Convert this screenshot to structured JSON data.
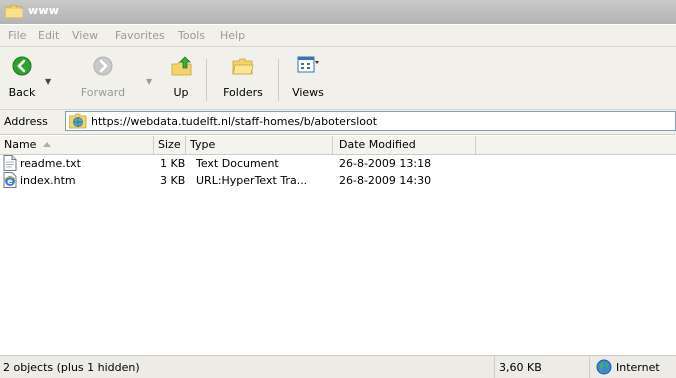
{
  "window": {
    "title": "www"
  },
  "menu": [
    "File",
    "Edit",
    "View",
    "Favorites",
    "Tools",
    "Help"
  ],
  "toolbar": {
    "back_label": "Back",
    "forward_label": "Forward",
    "up_label": "Up",
    "folders_label": "Folders",
    "views_label": "Views"
  },
  "address": {
    "label": "Address",
    "value": "https://webdata.tudelft.nl/staff-homes/b/abotersloot"
  },
  "columns": {
    "name": "Name",
    "size": "Size",
    "type": "Type",
    "date": "Date Modified"
  },
  "files": [
    {
      "name": "readme.txt",
      "size": "1 KB",
      "type": "Text Document",
      "date": "26-8-2009 13:18",
      "icon": "text-document-icon"
    },
    {
      "name": "index.htm",
      "size": "3 KB",
      "type": "URL:HyperText Tra...",
      "date": "26-8-2009 14:30",
      "icon": "html-document-icon"
    }
  ],
  "status": {
    "objects": "2 objects (plus 1 hidden)",
    "size": "3,60 KB",
    "zone": "Internet"
  },
  "colors": {
    "title_bar": "#b8b8b8",
    "chrome": "#f1f0ea",
    "address_border": "#7f9db9",
    "back_green": "#2fa12f"
  }
}
